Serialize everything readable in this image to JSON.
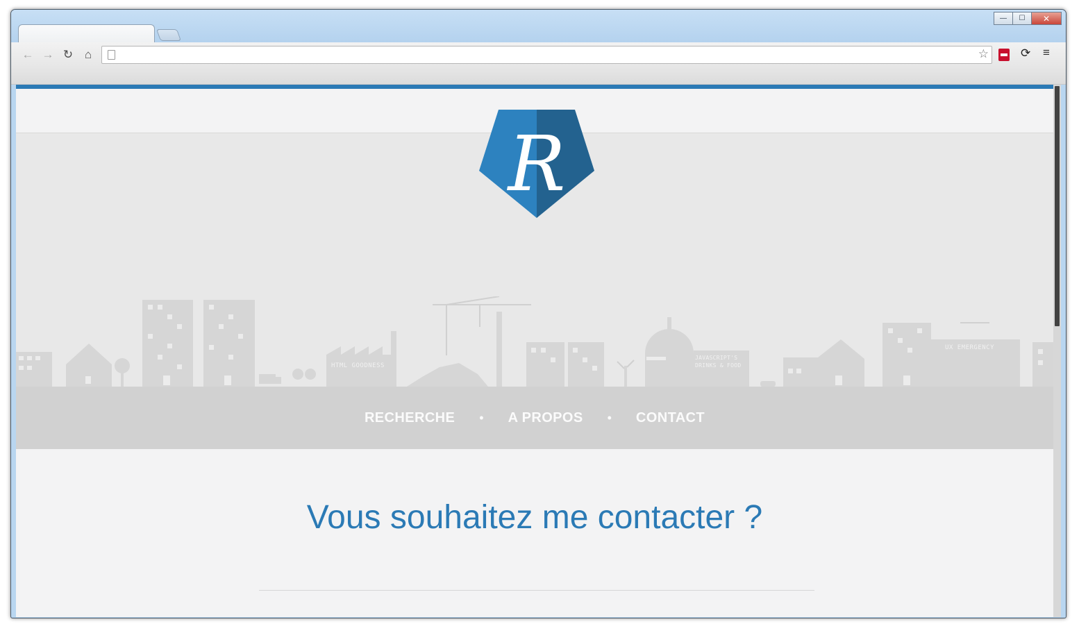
{
  "browser": {
    "window_buttons": {
      "minimize": "—",
      "maximize": "☐",
      "close": "✕"
    },
    "address_bar_value": "",
    "icons": [
      "back-icon",
      "forward-icon",
      "reload-icon",
      "home-icon",
      "star-icon",
      "menu-icon"
    ]
  },
  "site": {
    "accent_color": "#2b7ab5",
    "logo_letter": "R",
    "skyline_signs": {
      "html": "HTML GOODNESS",
      "js_line1": "JAVASCRIPT'S",
      "js_line2": "DRINKS & FOOD",
      "ux": "UX EMERGENCY"
    },
    "nav": [
      {
        "label": "RECHERCHE"
      },
      {
        "label": "A PROPOS"
      },
      {
        "label": "CONTACT"
      }
    ],
    "nav_separator": "•",
    "content_title": "Vous souhaitez me contacter ?"
  }
}
